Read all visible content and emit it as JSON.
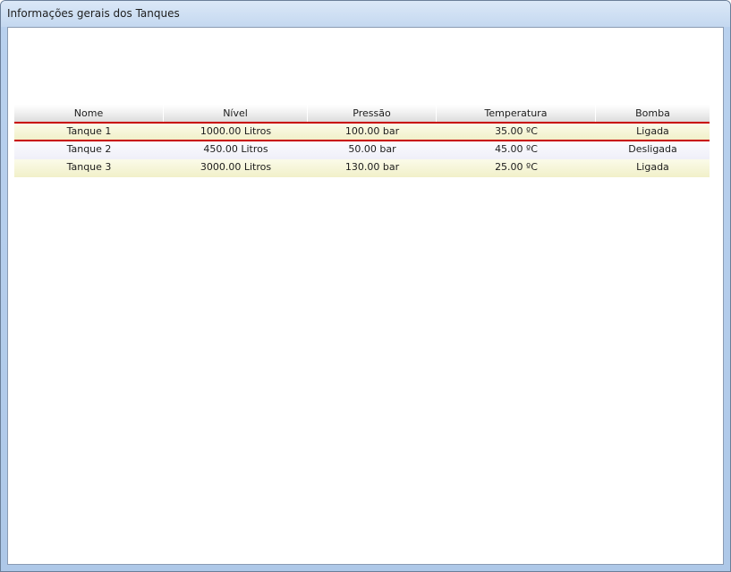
{
  "window": {
    "title": "Informações gerais dos Tanques"
  },
  "table": {
    "columns": [
      "Nome",
      "Nível",
      "Pressão",
      "Temperatura",
      "Bomba"
    ],
    "rows": [
      [
        "Tanque 1",
        "1000.00 Litros",
        "100.00 bar",
        "35.00 ºC",
        "Ligada"
      ],
      [
        "Tanque 2",
        "450.00 Litros",
        "50.00 bar",
        "45.00 ºC",
        "Desligada"
      ],
      [
        "Tanque 3",
        "3000.00 Litros",
        "130.00 bar",
        "25.00 ºC",
        "Ligada"
      ]
    ],
    "selected_row": 0
  },
  "colors": {
    "selection_border": "#c80000",
    "odd_row": "#f1f0c9",
    "even_row": "#efeff8"
  }
}
